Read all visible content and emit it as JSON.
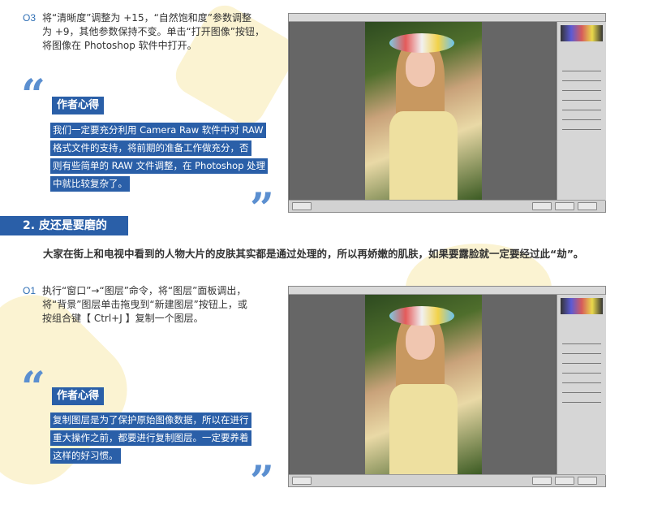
{
  "step_03": {
    "number": "O3",
    "line1": "将“清晰度”调整为 +15，“自然饱和度”参数调整",
    "line2": "为 +9，其他参数保持不变。单击“打开图像”按钮，",
    "line3": "将图像在 Photoshop 软件中打开。"
  },
  "tip1": {
    "title": "作者心得",
    "lines": [
      "我们一定要充分利用 Camera Raw 软件中对 RAW",
      "格式文件的支持，将前期的准备工作做充分，否",
      "则有些简单的 RAW 文件调整，在 Photoshop 处理",
      "中就比较复杂了。"
    ]
  },
  "section": {
    "title": "2. 皮还是要磨的"
  },
  "paragraph": "大家在街上和电视中看到的人物大片的皮肤其实都是通过处理的，所以再娇嫩的肌肤，如果要露脸就一定要经过此“劫”。",
  "step_01": {
    "number": "O1",
    "line1": "执行“窗口”→“图层”命令，将“图层”面板调出，",
    "line2": "将“背景”图层单击拖曳到“新建图层”按钮上，或",
    "line3": "按组合键【 Ctrl+J 】复制一个图层。"
  },
  "tip2": {
    "title": "作者心得",
    "lines": [
      "复制图层是为了保护原始图像数据，所以在进行",
      "重大操作之前，都要进行复制图层。一定要养着",
      "这样的好习惯。"
    ]
  },
  "quotes": {
    "open": "“",
    "close": "”"
  },
  "colors": {
    "accent": "#2a5fa8",
    "quote": "#5b8fd0",
    "deco": "#fbf3d2"
  }
}
